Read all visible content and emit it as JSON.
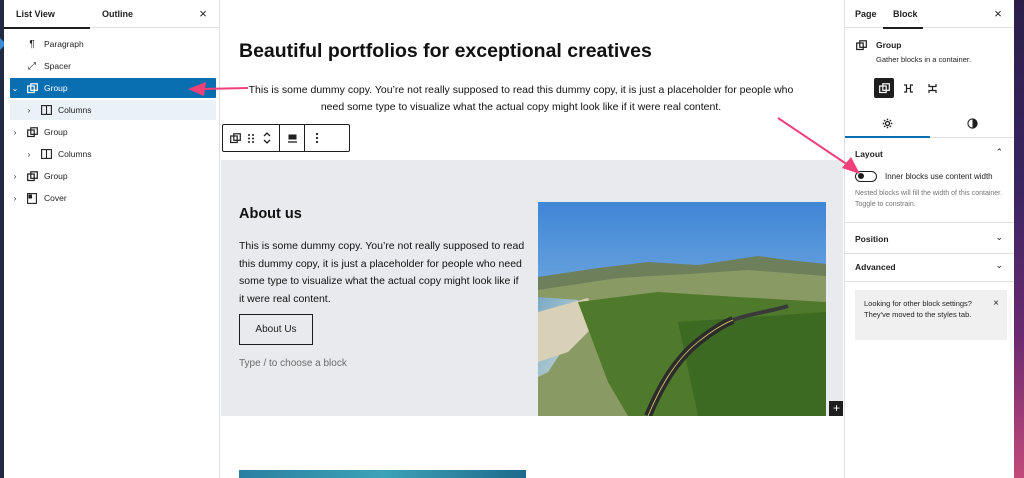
{
  "left_panel": {
    "tab_list_view": "List View",
    "tab_outline": "Outline",
    "close": "×",
    "items": [
      {
        "label": "Paragraph",
        "icon": "paragraph-icon"
      },
      {
        "label": "Spacer",
        "icon": "spacer-icon"
      },
      {
        "label": "Group",
        "icon": "group-icon"
      },
      {
        "label": "Columns",
        "icon": "columns-icon"
      },
      {
        "label": "Group",
        "icon": "group-icon"
      },
      {
        "label": "Columns",
        "icon": "columns-icon"
      },
      {
        "label": "Group",
        "icon": "group-icon"
      },
      {
        "label": "Cover",
        "icon": "cover-icon"
      }
    ]
  },
  "canvas": {
    "title": "Beautiful portfolios for exceptional creatives",
    "intro": "This is some dummy copy. You’re not really supposed to read this dummy copy, it is just a placeholder for people who need some type to visualize what the actual copy might look like if it were real content.",
    "about_heading": "About us",
    "about_text": "This is some dummy copy. You’re not really supposed to read this dummy copy, it is just a placeholder for people who need some type to visualize what the actual copy might look like if it were real content.",
    "about_button": "About Us",
    "type_hint": "Type / to choose a block",
    "add_block": "+"
  },
  "right_panel": {
    "tab_page": "Page",
    "tab_block": "Block",
    "close": "×",
    "block_title": "Group",
    "block_desc": "Gather blocks in a container.",
    "layout_title": "Layout",
    "toggle_label": "Inner blocks use content width",
    "toggle_on": false,
    "toggle_help": "Nested blocks will fill the width of this container. Toggle to constrain.",
    "position_title": "Position",
    "advanced_title": "Advanced",
    "notice_text": "Looking for other block settings? They've moved to the styles tab.",
    "notice_close": "×"
  },
  "colors": {
    "selection": "#0a6fb0",
    "annotation_arrow": "#f0407a",
    "group_background": "#e8eaed"
  }
}
